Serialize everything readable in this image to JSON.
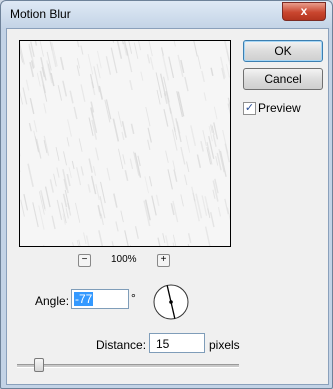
{
  "window": {
    "title": "Motion Blur",
    "close_glyph": "x"
  },
  "buttons": {
    "ok": "OK",
    "cancel": "Cancel"
  },
  "preview": {
    "label": "Preview",
    "checked": true
  },
  "zoom": {
    "minus": "−",
    "plus": "+",
    "level": "100%"
  },
  "angle": {
    "label": "Angle:",
    "value": "-77",
    "unit": "°"
  },
  "distance": {
    "label": "Distance:",
    "value": "15",
    "unit": "pixels"
  },
  "slider": {
    "level": 0.07
  }
}
